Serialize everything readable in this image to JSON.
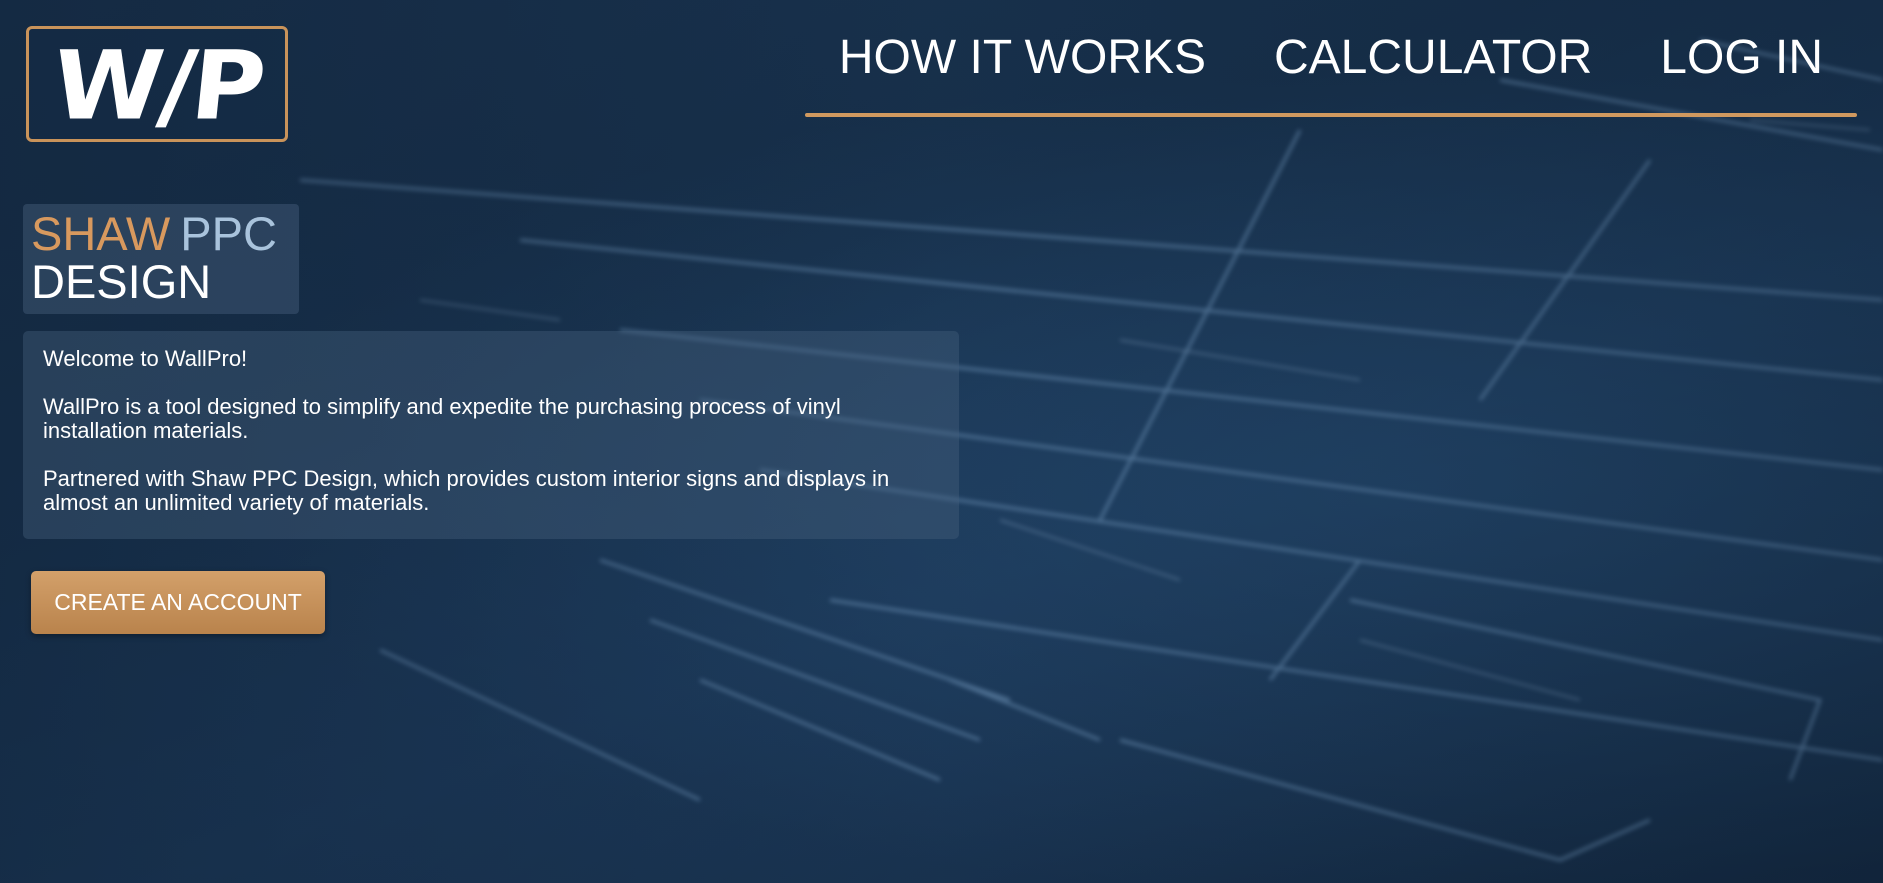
{
  "logo": {
    "text": "W/P"
  },
  "nav": {
    "items": [
      {
        "label": "HOW IT WORKS"
      },
      {
        "label": "CALCULATOR"
      },
      {
        "label": "LOG IN"
      }
    ],
    "underline_color": "#d0995f"
  },
  "brand": {
    "word1": "SHAW",
    "word2": "PPC",
    "word3": "DESIGN",
    "word1_color": "#d8995e",
    "word2_color": "#a9c3dc"
  },
  "intro": {
    "greeting": "Welcome to WallPro!",
    "description": "WallPro is a tool designed to simplify and expedite the purchasing process of vinyl installation materials.",
    "partner": "Partnered with Shaw PPC Design, which provides custom interior signs and displays in almost an unlimited variety of materials."
  },
  "cta": {
    "label": "CREATE AN ACCOUNT"
  },
  "colors": {
    "accent": "#c9935a",
    "background": "#17304b"
  },
  "background_image": {
    "description_icon": "blueprint-background"
  }
}
